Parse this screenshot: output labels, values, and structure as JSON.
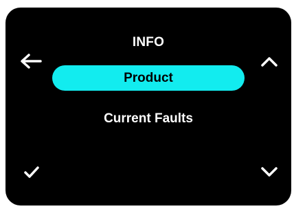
{
  "colors": {
    "screen_background": "#000000",
    "text": "#ffffff",
    "selection_highlight": "#12ecef",
    "selected_text": "#000000"
  },
  "header": {
    "title": "INFO"
  },
  "menu": {
    "items": [
      {
        "label": "Product",
        "selected": true
      },
      {
        "label": "Current Faults",
        "selected": false
      }
    ]
  },
  "controls": {
    "back_icon": "arrow-left-icon",
    "up_icon": "chevron-up-icon",
    "confirm_icon": "checkmark-icon",
    "down_icon": "chevron-down-icon"
  }
}
